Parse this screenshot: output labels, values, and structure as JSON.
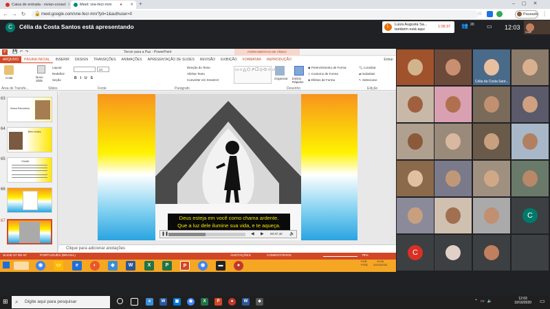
{
  "browser": {
    "tabs": [
      {
        "label": "Caixa de entrada - vivian-consel",
        "color": "#d93025"
      },
      {
        "label": "Meet: vne-fecr-mnr",
        "color": "#00897b"
      }
    ],
    "new_tab_symbol": "+",
    "url": "meet.google.com/vne-fecr-mnr?pli=1&authuser=0",
    "profile_status": "Pausado"
  },
  "meet": {
    "presenter_initial": "C",
    "presenting_text": "Célia da Costa Santos está apresentando",
    "notification_initial": "L",
    "notification_line1": "Luiza Augusta Sa...",
    "notification_line2": "também está aqui",
    "timer": "1:05:37",
    "participant_count": "20",
    "clock": "12:03",
    "self_label": "Você",
    "featured_tile_name": "Célia da Costa Sant...",
    "empty_initials": [
      "C",
      "C"
    ]
  },
  "powerpoint": {
    "title": "Tercer para a Paz - PowerPoint",
    "context_tab_header": "FERRAMENTAS DE VÍDEO",
    "ribbon_tabs": [
      "ARQUIVO",
      "PÁGINA INICIAL",
      "INSERIR",
      "DESIGN",
      "TRANSIÇÕES",
      "ANIMAÇÕES",
      "APRESENTAÇÃO DE SLIDES",
      "REVISÃO",
      "EXIBIÇÃO",
      "FORMATAR",
      "REPRODUÇÃO"
    ],
    "groups": {
      "clipboard": "Área de Transfe...",
      "slides": "Slides",
      "font": "Fonte",
      "paragraph": "Parágrafo",
      "drawing": "Desenho",
      "editing": "Edição"
    },
    "buttons": {
      "paste": "Colar",
      "new_slide": "Novo Slide",
      "layout": "Layout",
      "reset": "Redefinir",
      "section": "Seção",
      "text_direction": "Direção do Texto",
      "align_text": "Alinhar Texto",
      "smartart": "Converter em SmartArt",
      "arrange": "Organizar",
      "quick_styles": "Estilos Rápidos",
      "shape_fill": "Preenchimento de Forma",
      "shape_outline": "Contorno de Forma",
      "shape_effects": "Efeitos de Forma",
      "find": "Localizar",
      "replace": "Substituir",
      "select": "Selecionar",
      "entrar": "Entrar",
      "font_size": "24"
    },
    "slide_numbers": [
      "63",
      "64",
      "65",
      "66",
      "67"
    ],
    "thumb_texts": [
      "Nossa Educadora",
      "Bem-vindos",
      "Oração",
      "",
      ""
    ],
    "subtitle_line1": "Deus esteja em você como chama ardente.",
    "subtitle_line2": "Que a luz dele ilumine sua vida, e te aqueça.",
    "video_time": "00:37,40",
    "notes_placeholder": "Clique para adicionar anotações",
    "status": {
      "slide": "SLIDE 67 DE 67",
      "language": "PORTUGUÊS (BRASIL)",
      "notes": "ANOTAÇÕES",
      "comments": "COMENTÁRIOS",
      "zoom": "79%"
    }
  },
  "taskbar": {
    "search_placeholder": "Digite aqui para pesquisar",
    "lang_line1": "POR",
    "lang_line2": "PTB2",
    "inner_time": "12:06",
    "inner_date": "10/10/2020",
    "time": "12:03",
    "date": "10/10/2020"
  }
}
